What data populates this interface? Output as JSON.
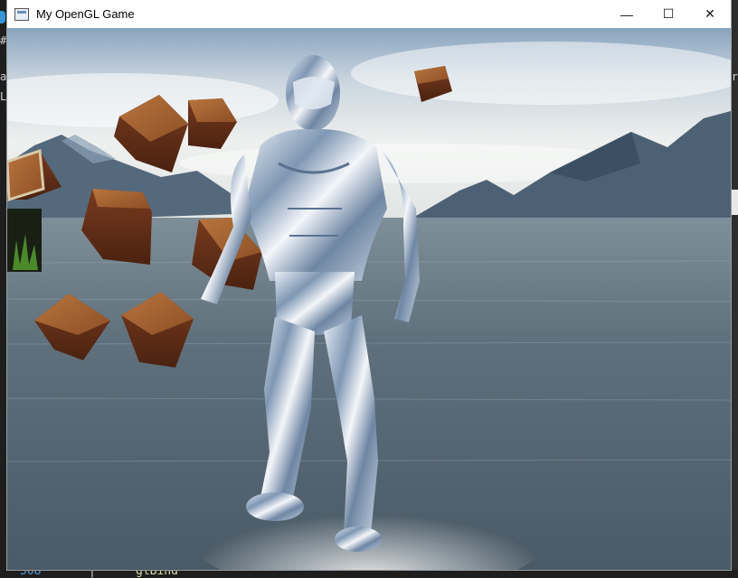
{
  "window": {
    "title": "My OpenGL Game",
    "icon": "app-window-icon",
    "controls": {
      "minimize_glyph": "—",
      "maximize_glyph": "☐",
      "close_glyph": "✕"
    }
  },
  "background_ide": {
    "left_fragments": [
      "#",
      "ai",
      "L"
    ],
    "right_fragment": "er",
    "bottom_line_number": "508",
    "bottom_separator": "|",
    "bottom_code": "glBind"
  },
  "scene": {
    "description_icons": [
      "crate-icon",
      "grass-icon",
      "character-icon",
      "mountain-icon",
      "water-icon"
    ],
    "colors": {
      "sky_top": "#9fb7cf",
      "sky_mid": "#dfe6ea",
      "water": "#5c6f7c",
      "mountains": "#4b6073",
      "crate": "#7a3b1f"
    }
  }
}
